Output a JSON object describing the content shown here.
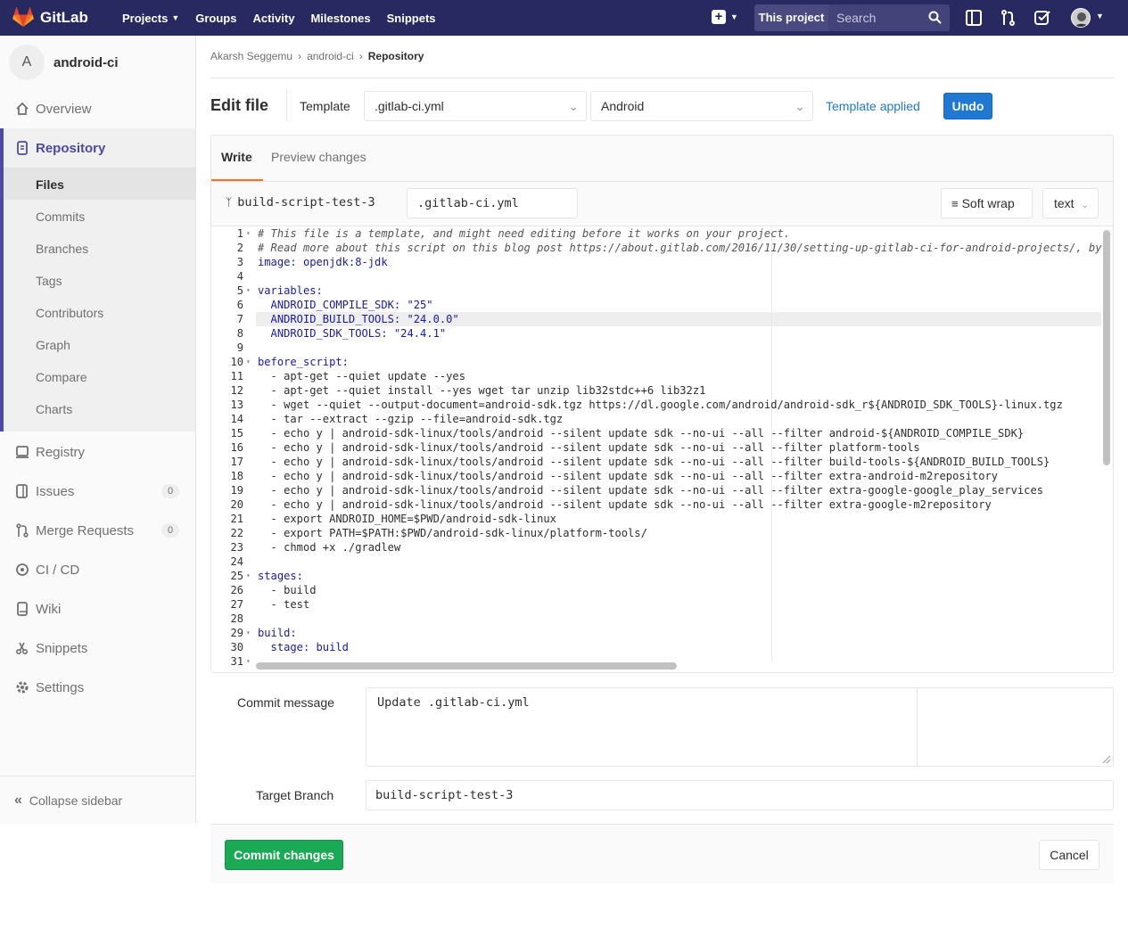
{
  "topnav": {
    "brand": "GitLab",
    "links": [
      {
        "label": "Projects",
        "caret": true
      },
      {
        "label": "Groups"
      },
      {
        "label": "Activity"
      },
      {
        "label": "Milestones"
      },
      {
        "label": "Snippets"
      }
    ],
    "scope_label": "This project",
    "search_placeholder": "Search"
  },
  "sidebar": {
    "project_initial": "A",
    "project_name": "android-ci",
    "items": {
      "overview": "Overview",
      "repository": "Repository",
      "registry": "Registry",
      "issues": "Issues",
      "issues_count": "0",
      "merge_requests": "Merge Requests",
      "merge_requests_count": "0",
      "cicd": "CI / CD",
      "wiki": "Wiki",
      "snippets": "Snippets",
      "settings": "Settings"
    },
    "repo_sub": [
      "Files",
      "Commits",
      "Branches",
      "Tags",
      "Contributors",
      "Graph",
      "Compare",
      "Charts"
    ],
    "collapse_label": "Collapse sidebar"
  },
  "breadcrumb": {
    "user": "Akarsh Seggemu",
    "project": "android-ci",
    "current": "Repository"
  },
  "editor_header": {
    "title": "Edit file",
    "template_label": "Template",
    "template_type": ".gitlab-ci.yml",
    "template_name": "Android",
    "applied_text": "Template applied",
    "undo_label": "Undo"
  },
  "tabs": {
    "write": "Write",
    "preview": "Preview changes"
  },
  "file_bar": {
    "branch": "build-script-test-3",
    "filename": ".gitlab-ci.yml",
    "soft_wrap": "Soft wrap",
    "mode": "text"
  },
  "code_lines": [
    {
      "n": "1",
      "fold": true,
      "t": "# This file is a template, and might need editing before it works on your project.",
      "c": "comment"
    },
    {
      "n": "2",
      "t": "# Read more about this script on this blog post https://about.gitlab.com/2016/11/30/setting-up-gitlab-ci-for-android-projects/, by",
      "c": "comment"
    },
    {
      "n": "3",
      "t": "image: openjdk:8-jdk",
      "c": "key"
    },
    {
      "n": "4",
      "t": ""
    },
    {
      "n": "5",
      "fold": true,
      "t": "variables:",
      "c": "key"
    },
    {
      "n": "6",
      "t": "  ANDROID_COMPILE_SDK: \"25\"",
      "c": "key"
    },
    {
      "n": "7",
      "t": "  ANDROID_BUILD_TOOLS: \"24.0.0\"",
      "c": "key"
    },
    {
      "n": "8",
      "t": "  ANDROID_SDK_TOOLS: \"24.4.1\"",
      "c": "key"
    },
    {
      "n": "9",
      "t": ""
    },
    {
      "n": "10",
      "fold": true,
      "t": "before_script:",
      "c": "key"
    },
    {
      "n": "11",
      "t": "  - apt-get --quiet update --yes"
    },
    {
      "n": "12",
      "t": "  - apt-get --quiet install --yes wget tar unzip lib32stdc++6 lib32z1"
    },
    {
      "n": "13",
      "t": "  - wget --quiet --output-document=android-sdk.tgz https://dl.google.com/android/android-sdk_r${ANDROID_SDK_TOOLS}-linux.tgz"
    },
    {
      "n": "14",
      "t": "  - tar --extract --gzip --file=android-sdk.tgz"
    },
    {
      "n": "15",
      "t": "  - echo y | android-sdk-linux/tools/android --silent update sdk --no-ui --all --filter android-${ANDROID_COMPILE_SDK}"
    },
    {
      "n": "16",
      "t": "  - echo y | android-sdk-linux/tools/android --silent update sdk --no-ui --all --filter platform-tools"
    },
    {
      "n": "17",
      "t": "  - echo y | android-sdk-linux/tools/android --silent update sdk --no-ui --all --filter build-tools-${ANDROID_BUILD_TOOLS}"
    },
    {
      "n": "18",
      "t": "  - echo y | android-sdk-linux/tools/android --silent update sdk --no-ui --all --filter extra-android-m2repository"
    },
    {
      "n": "19",
      "t": "  - echo y | android-sdk-linux/tools/android --silent update sdk --no-ui --all --filter extra-google-google_play_services"
    },
    {
      "n": "20",
      "t": "  - echo y | android-sdk-linux/tools/android --silent update sdk --no-ui --all --filter extra-google-m2repository"
    },
    {
      "n": "21",
      "t": "  - export ANDROID_HOME=$PWD/android-sdk-linux"
    },
    {
      "n": "22",
      "t": "  - export PATH=$PATH:$PWD/android-sdk-linux/platform-tools/"
    },
    {
      "n": "23",
      "t": "  - chmod +x ./gradlew"
    },
    {
      "n": "24",
      "t": ""
    },
    {
      "n": "25",
      "fold": true,
      "t": "stages:",
      "c": "key"
    },
    {
      "n": "26",
      "t": "  - build"
    },
    {
      "n": "27",
      "t": "  - test"
    },
    {
      "n": "28",
      "t": ""
    },
    {
      "n": "29",
      "fold": true,
      "t": "build:",
      "c": "key"
    },
    {
      "n": "30",
      "t": "  stage: build",
      "c": "key"
    },
    {
      "n": "31",
      "fold": true,
      "t": ""
    }
  ],
  "commit": {
    "message_label": "Commit message",
    "message": "Update .gitlab-ci.yml",
    "target_label": "Target Branch",
    "target_branch": "build-script-test-3",
    "commit_label": "Commit changes",
    "cancel_label": "Cancel"
  },
  "colors": {
    "nav_bg": "#292961",
    "accent_blue": "#1f78d1",
    "commit_green": "#1aaa55",
    "tab_underline": "#fc6d26"
  }
}
